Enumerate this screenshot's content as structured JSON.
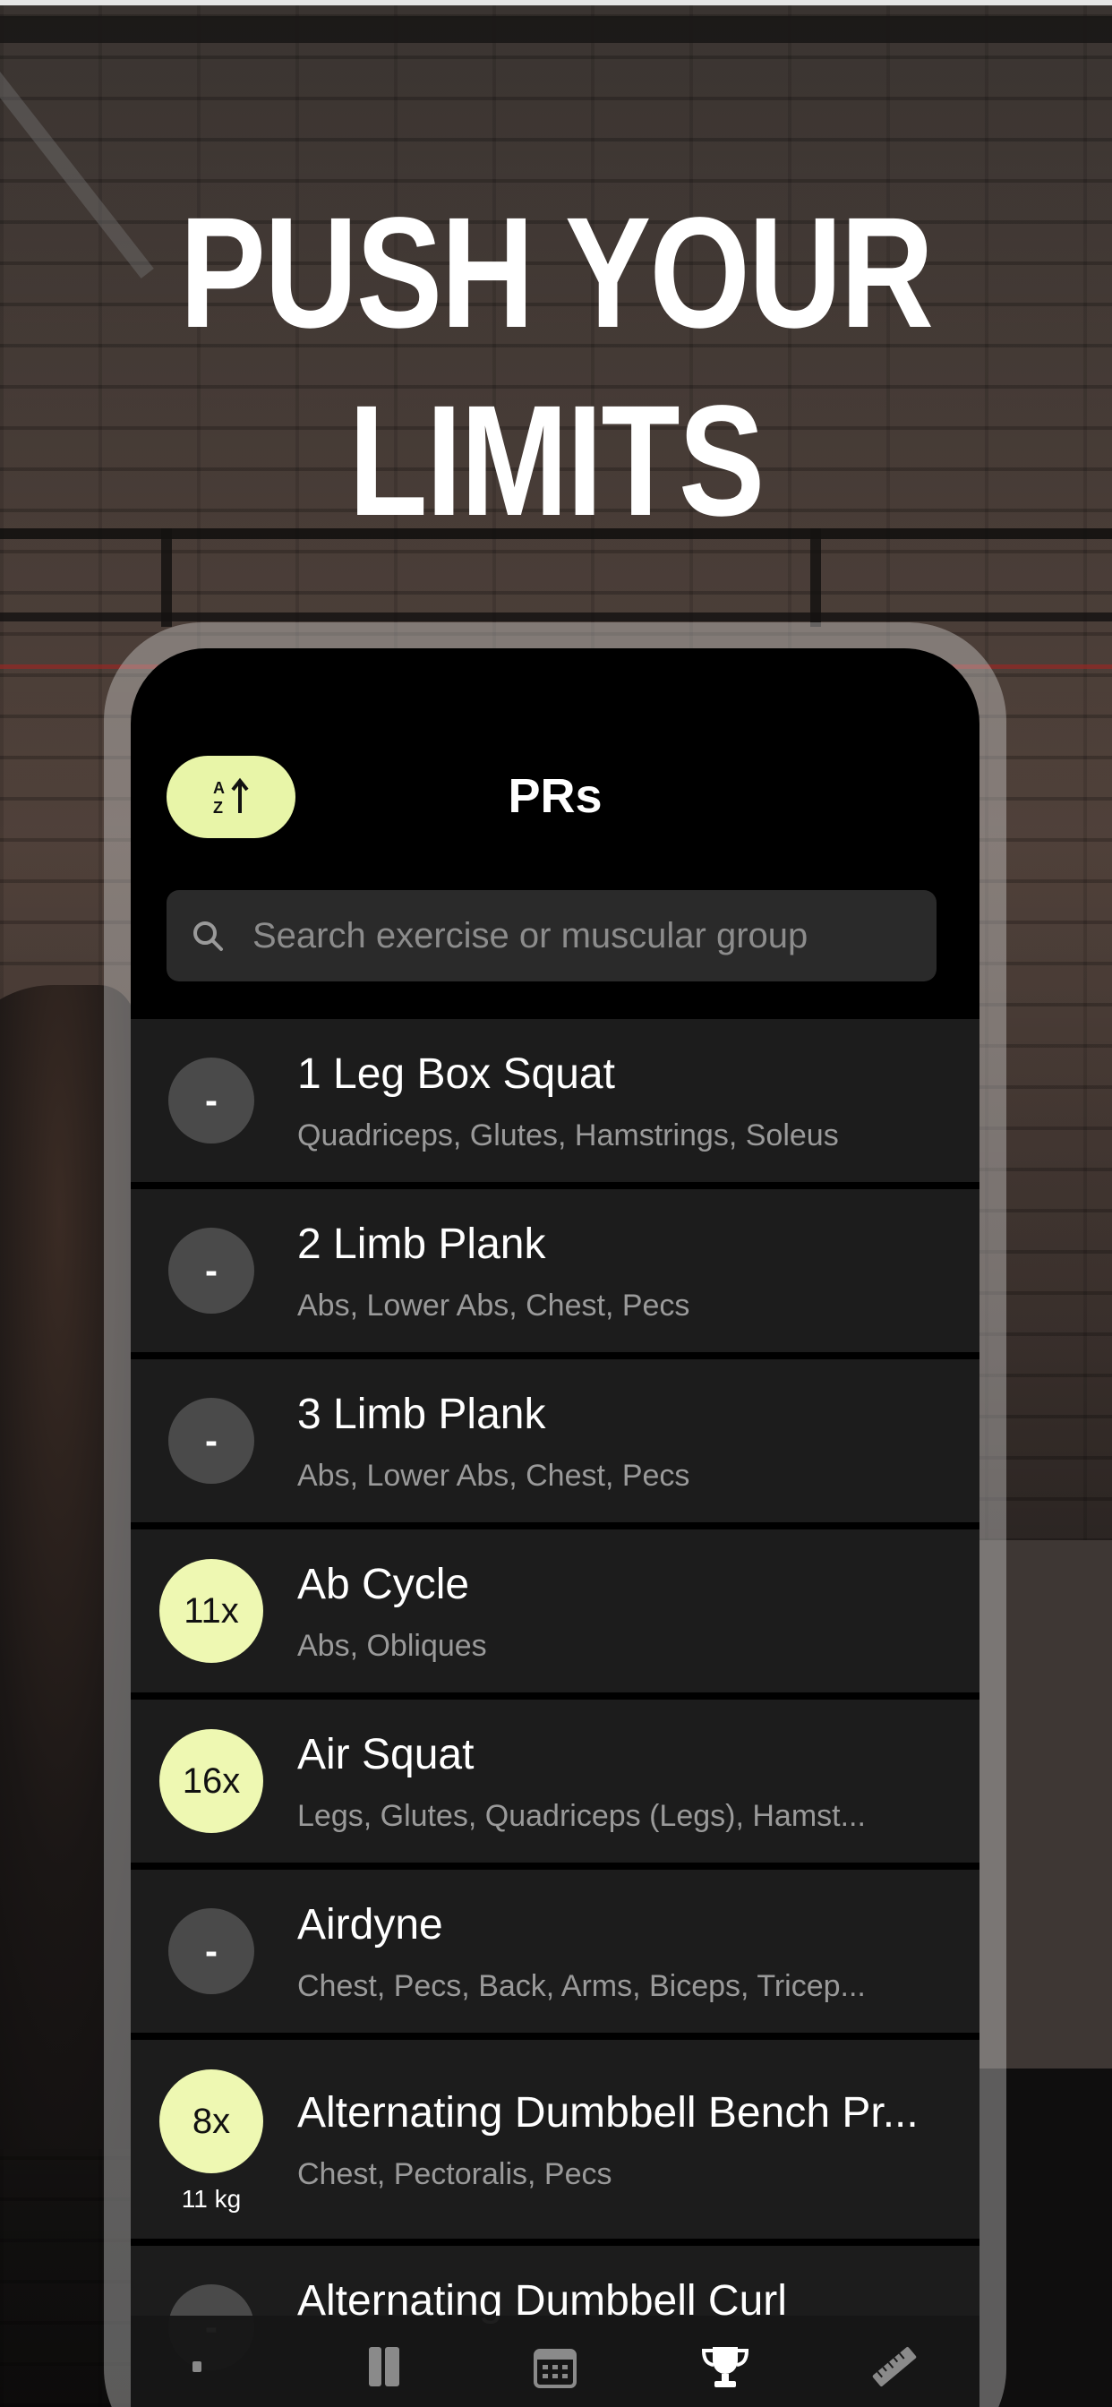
{
  "headline": {
    "line1": "PUSH YOUR",
    "line2": "LIMITS"
  },
  "app": {
    "title": "PRs",
    "sort_button_icon": "sort-az-icon",
    "search": {
      "placeholder": "Search exercise or muscular group",
      "value": ""
    },
    "exercises": [
      {
        "name": "1 Leg Box Squat",
        "muscles": "Quadriceps, Glutes, Hamstrings, Soleus",
        "badge": "-",
        "weight": ""
      },
      {
        "name": "2 Limb Plank",
        "muscles": "Abs, Lower Abs, Chest, Pecs",
        "badge": "-",
        "weight": ""
      },
      {
        "name": "3 Limb Plank",
        "muscles": "Abs, Lower Abs, Chest, Pecs",
        "badge": "-",
        "weight": ""
      },
      {
        "name": "Ab Cycle",
        "muscles": "Abs, Obliques",
        "badge": "11x",
        "weight": ""
      },
      {
        "name": "Air Squat",
        "muscles": "Legs, Glutes, Quadriceps (Legs), Hamst...",
        "badge": "16x",
        "weight": ""
      },
      {
        "name": "Airdyne",
        "muscles": "Chest, Pecs, Back, Arms, Biceps, Tricep...",
        "badge": "-",
        "weight": ""
      },
      {
        "name": "Alternating Dumbbell Bench Pr...",
        "muscles": "Chest, Pectoralis, Pecs",
        "badge": "8x",
        "weight": "11 kg"
      },
      {
        "name": "Alternating Dumbbell Curl",
        "muscles": "",
        "badge": "-",
        "weight": ""
      }
    ],
    "tabs": [
      {
        "icon": "dumbbell-icon",
        "active": false
      },
      {
        "icon": "notebook-icon",
        "active": false
      },
      {
        "icon": "calendar-icon",
        "active": false
      },
      {
        "icon": "trophy-icon",
        "active": true
      },
      {
        "icon": "ruler-icon",
        "active": false
      }
    ],
    "colors": {
      "accent": "#eef8b2",
      "row_bg": "#1c1c1c",
      "inactive_badge": "#4a4a4a"
    }
  }
}
